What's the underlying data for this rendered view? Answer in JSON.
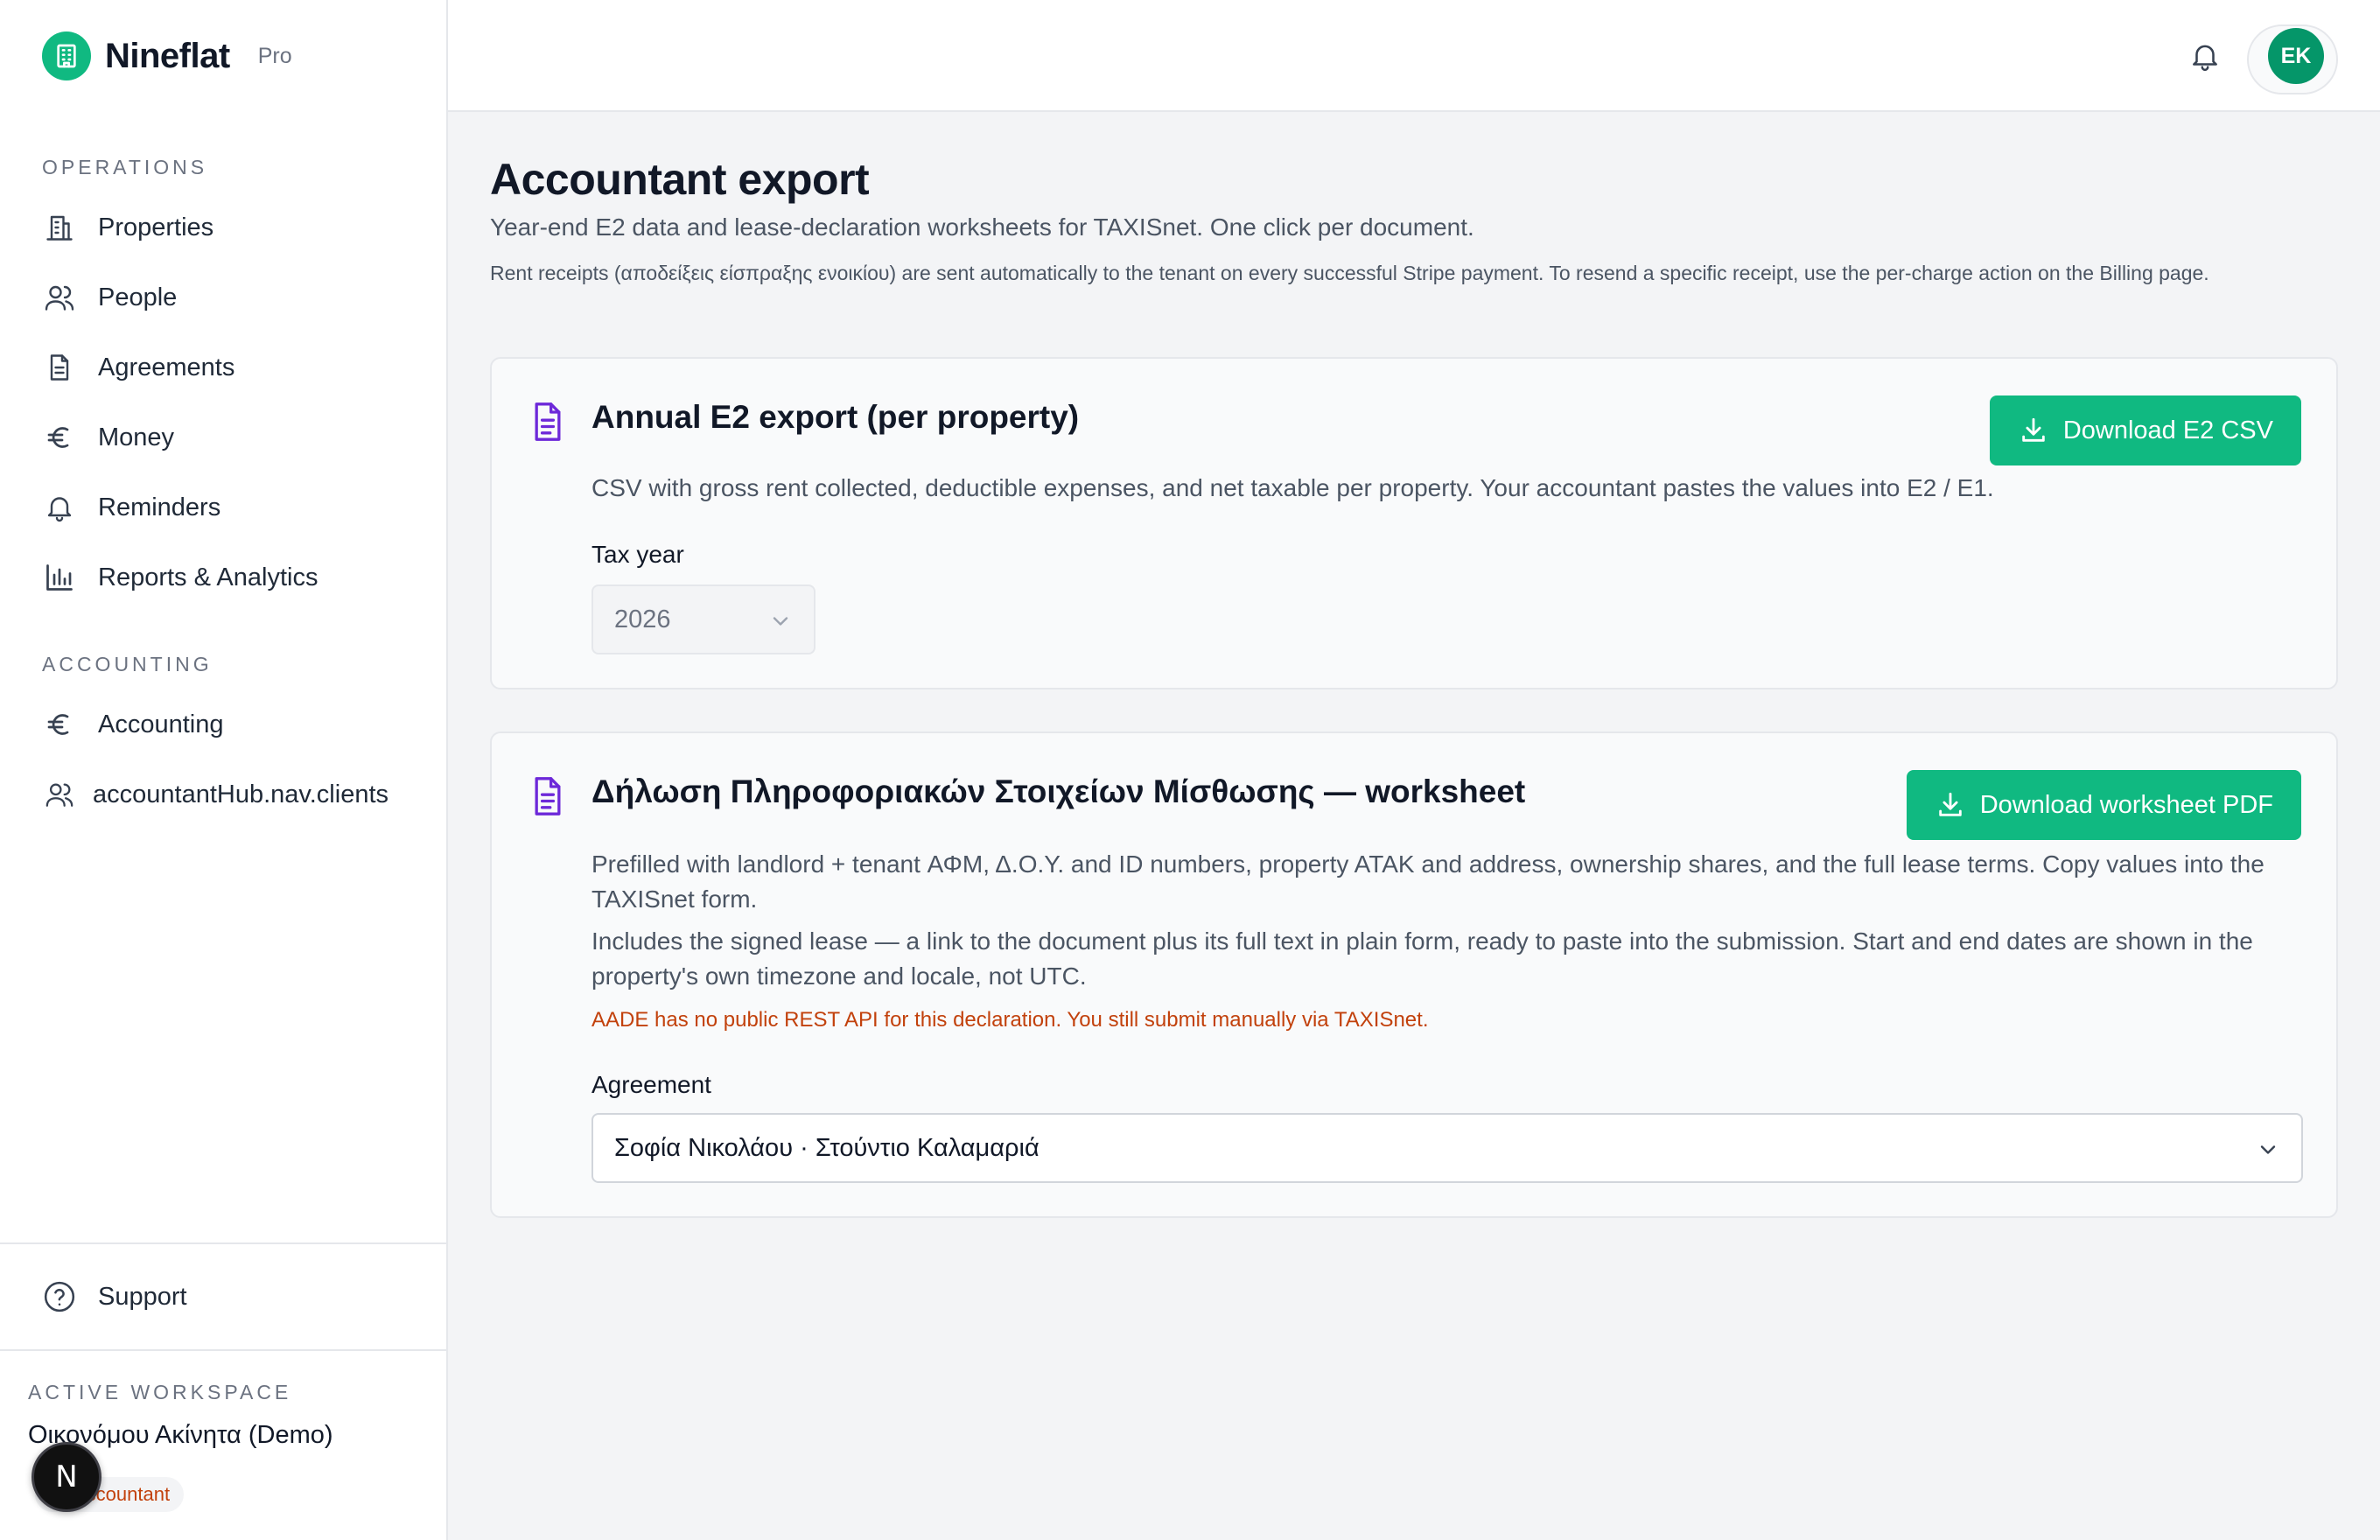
{
  "brand": {
    "name": "Nineflat",
    "plan": "Pro"
  },
  "sidebar": {
    "sections": [
      {
        "label": "OPERATIONS",
        "items": [
          {
            "label": "Properties",
            "icon": "building-icon"
          },
          {
            "label": "People",
            "icon": "users-icon"
          },
          {
            "label": "Agreements",
            "icon": "document-icon"
          },
          {
            "label": "Money",
            "icon": "euro-icon"
          },
          {
            "label": "Reminders",
            "icon": "bell-icon"
          },
          {
            "label": "Reports & Analytics",
            "icon": "bar-chart-icon"
          }
        ]
      },
      {
        "label": "ACCOUNTING",
        "items": [
          {
            "label": "Accounting",
            "icon": "euro-icon"
          },
          {
            "label": "accountantHub.nav.clients",
            "icon": "users-icon"
          }
        ]
      }
    ],
    "support": {
      "label": "Support",
      "icon": "help-circle-icon"
    },
    "workspace": {
      "section_label": "ACTIVE WORKSPACE",
      "name": "Οικονόμου Ακίνητα (Demo)",
      "role": "Accountant"
    },
    "dev_badge": "N"
  },
  "header": {
    "avatar_initials": "EK",
    "notifications_icon": "bell-icon"
  },
  "main": {
    "title": "Accountant export",
    "subtitle": "Year-end E2 data and lease-declaration worksheets for TAXISnet. One click per document.",
    "note": "Rent receipts (αποδείξεις είσπραξης ενοικίου) are sent automatically to the tenant on every successful Stripe payment. To resend a specific receipt, use the per-charge action on the Billing page.",
    "cards": [
      {
        "title": "Annual E2 export (per property)",
        "description": "CSV with gross rent collected, deductible expenses, and net taxable per property. Your accountant pastes the values into E2 / E1.",
        "button": "Download E2 CSV",
        "field_label": "Tax year",
        "field_value": "2026"
      },
      {
        "title": "Δήλωση Πληροφοριακών Στοιχείων Μίσθωσης — worksheet",
        "description_1": "Prefilled with landlord + tenant ΑΦΜ, Δ.Ο.Υ. and ID numbers, property ATAK and address, ownership shares, and the full lease terms. Copy values into the TAXISnet form.",
        "description_2": "Includes the signed lease — a link to the document plus its full text in plain form, ready to paste into the submission. Start and end dates are shown in the property's own timezone and locale, not UTC.",
        "warning": "AADE has no public REST API for this declaration. You still submit manually via TAXISnet.",
        "button": "Download worksheet PDF",
        "field_label": "Agreement",
        "field_value": "Σοφία Νικολάου · Στούντιο Καλαμαριά"
      }
    ]
  },
  "colors": {
    "accent": "#10b981",
    "accent_dark": "#059669",
    "card_icon": "#6d28d9",
    "warning": "#c2410c"
  }
}
